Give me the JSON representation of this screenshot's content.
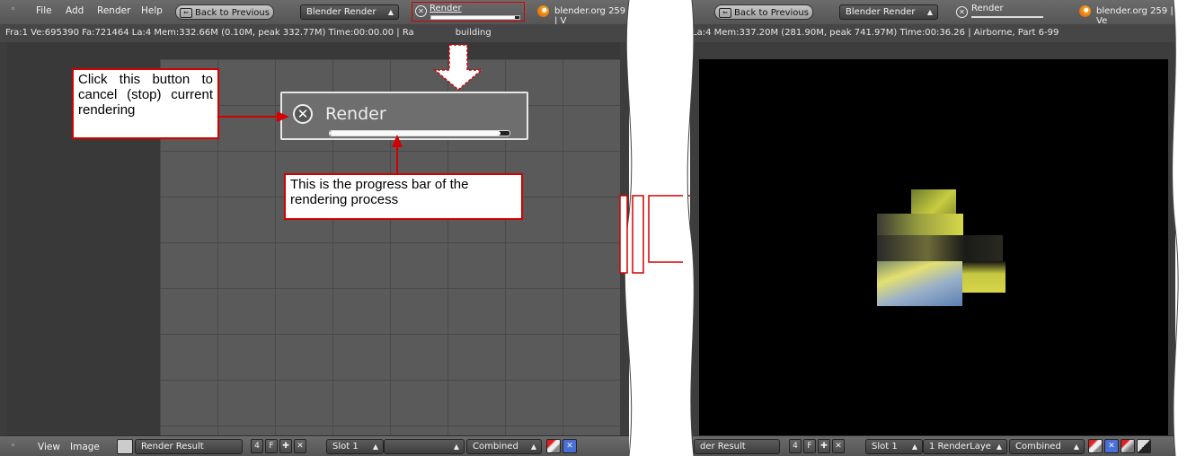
{
  "left": {
    "menu": [
      "File",
      "Add",
      "Render",
      "Help"
    ],
    "back_label": "Back to Previous",
    "engine": "Blender Render",
    "render_label": "Render",
    "blender_info": "blender.org 259 | V",
    "status": "Fra:1 Ve:695390 Fa:721464 La:4 Mem:332.66M (0.10M, peak 332.77M) Time:00:00.00 | Ra",
    "status_tail": "building",
    "bottom": {
      "view": "View",
      "image": "Image",
      "image_name": "Render Result",
      "users": "4",
      "fake": "F",
      "slot": "Slot 1",
      "pass": "Combined"
    },
    "zoom_render_label": "Render",
    "callout_cancel": "Click this button to cancel (stop) current rendering",
    "callout_progress": "This is the progress bar of the rendering process"
  },
  "right": {
    "back_label": "Back to Previous",
    "engine": "Blender Render",
    "render_label": "Render",
    "blender_info": "blender.org 259 | Ve",
    "status": "La:4 Mem:337.20M (281.90M, peak 741.97M) Time:00:36.26 | Airborne, Part 6-99",
    "bottom": {
      "image_name": "der Result",
      "users": "4",
      "fake": "F",
      "slot": "Slot 1",
      "layer": "1 RenderLaye",
      "pass": "Combined"
    }
  },
  "progress": 0.95,
  "colors": {
    "highlight": "#d40000"
  }
}
